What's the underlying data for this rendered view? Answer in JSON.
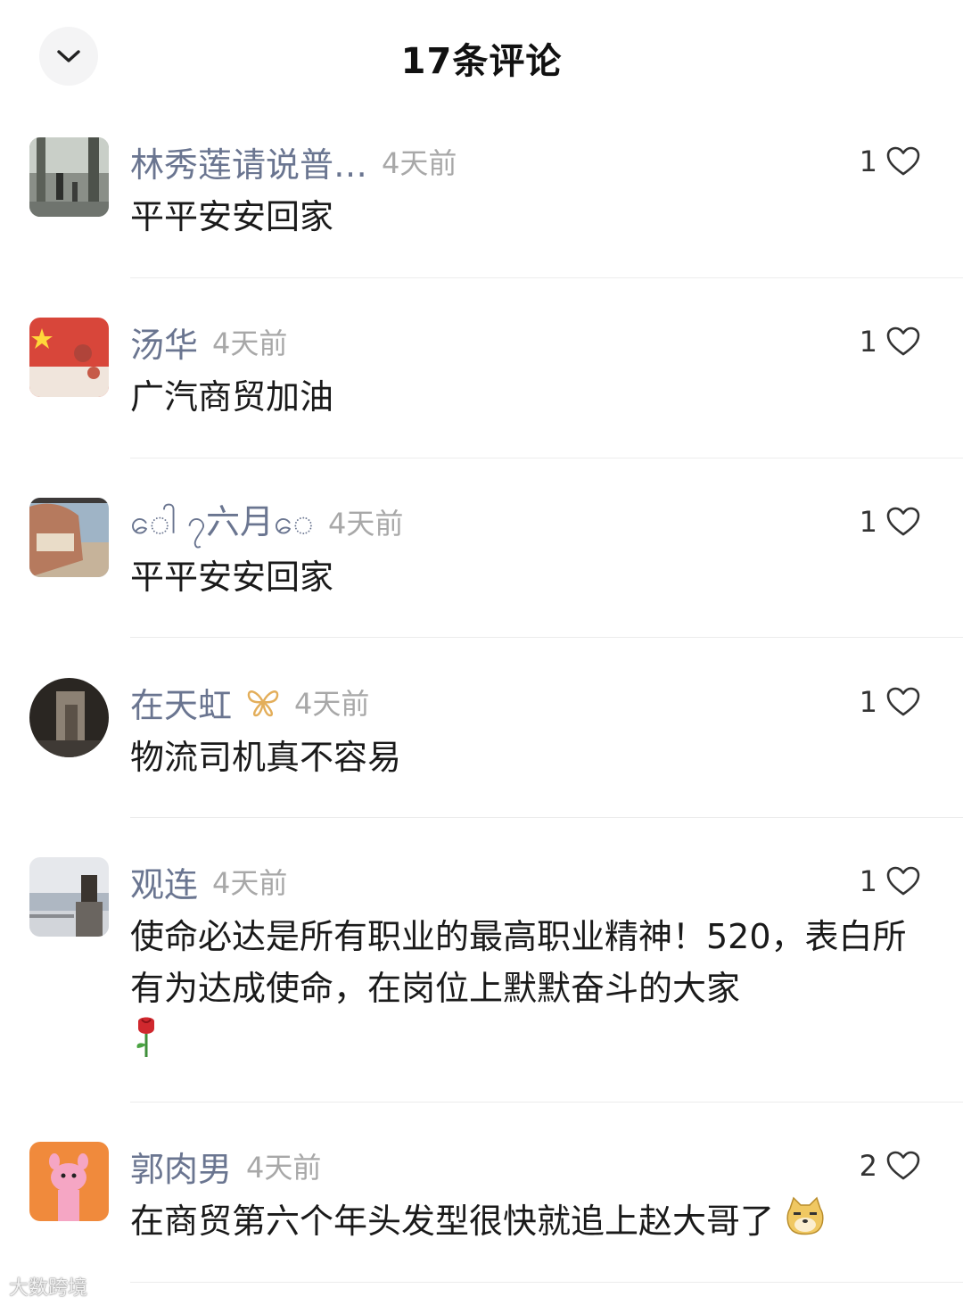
{
  "header": {
    "title": "17条评论"
  },
  "comments": [
    {
      "username": "林秀莲请说普…",
      "time": "4天前",
      "likes": "1",
      "text": "平平安安回家"
    },
    {
      "username": "汤华",
      "time": "4天前",
      "likes": "1",
      "text": "广汽商贸加油"
    },
    {
      "username": "ေါ ၇六月ေ",
      "time": "4天前",
      "likes": "1",
      "text": "平平安安回家"
    },
    {
      "username": "在天虹",
      "time": "4天前",
      "likes": "1",
      "text": "物流司机真不容易",
      "badge_icon": "butterfly-badge-icon"
    },
    {
      "username": "观连",
      "time": "4天前",
      "likes": "1",
      "text": "使命必达是所有职业的最高职业精神！520，表白所有为达成使命，在岗位上默默奋斗的大家",
      "emoji": "rose-emoji"
    },
    {
      "username": "郭肉男",
      "time": "4天前",
      "likes": "2",
      "text": "在商贸第六个年头发型很快就追上赵大哥了",
      "emoji": "doge-emoji"
    }
  ],
  "watermark": "大数跨境",
  "colors": {
    "username": "#6a7590",
    "time": "#a8a8a8",
    "text": "#1a1a1a",
    "divider": "#ececec"
  }
}
